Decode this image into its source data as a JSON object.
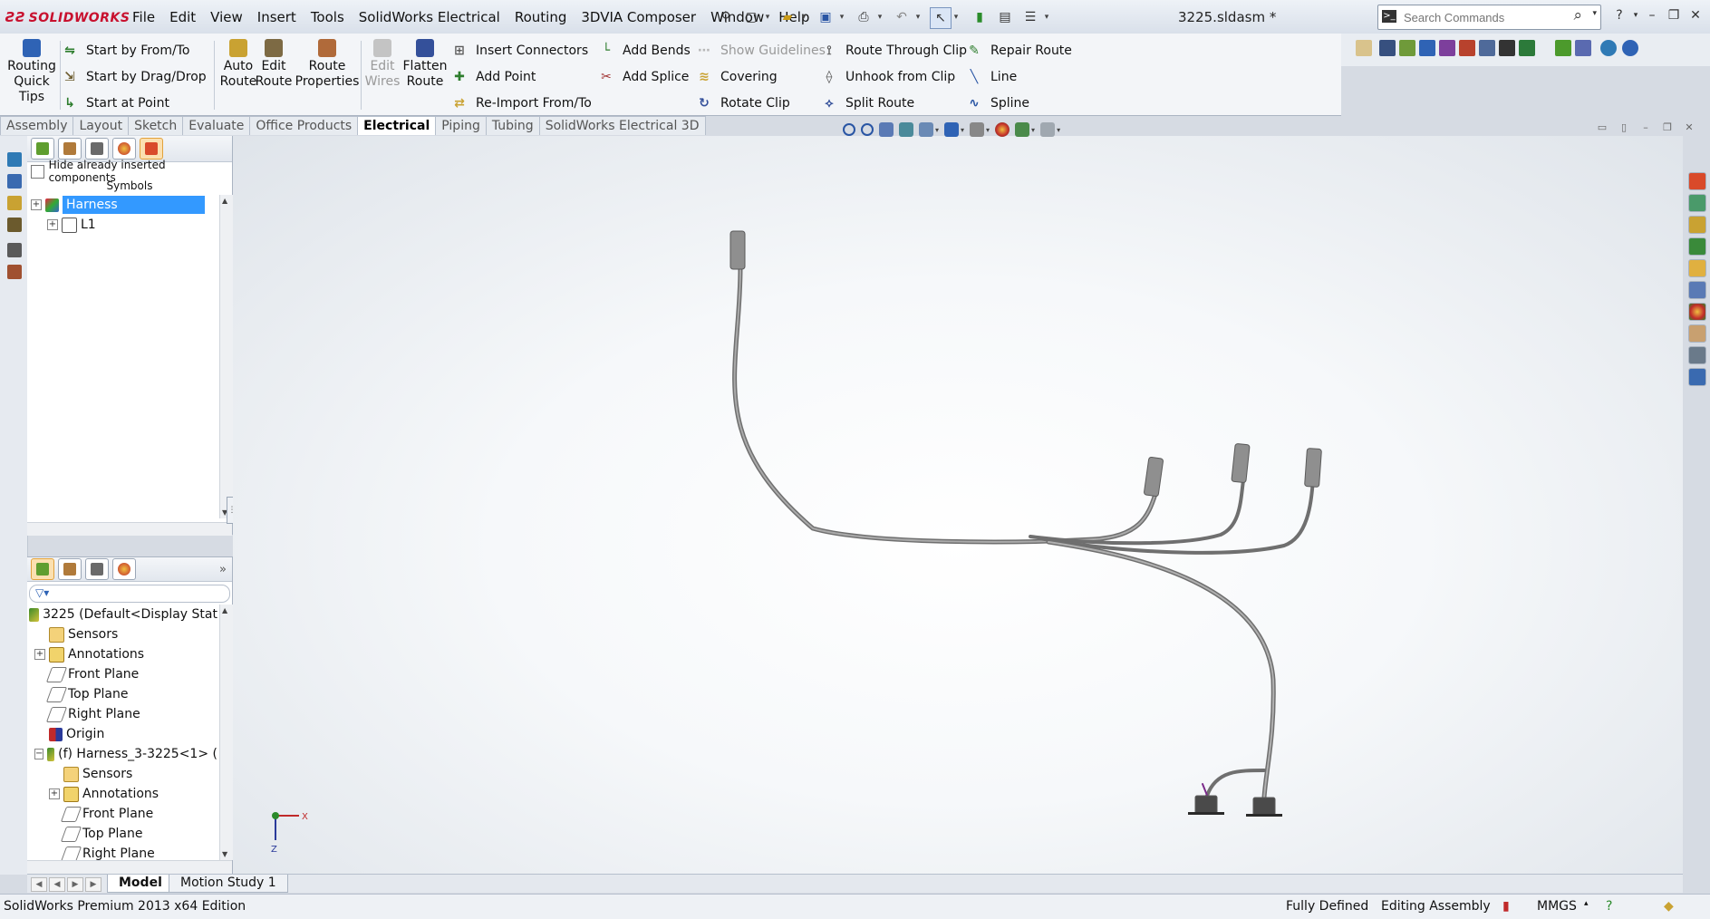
{
  "app": {
    "logo": "SOLIDWORKS",
    "document_title": "3225.sldasm *"
  },
  "menu": [
    "File",
    "Edit",
    "View",
    "Insert",
    "Tools",
    "SolidWorks Electrical",
    "Routing",
    "3DVIA Composer",
    "Window",
    "Help"
  ],
  "search": {
    "placeholder": "Search Commands"
  },
  "toolbar": {
    "big_buttons": [
      {
        "label": "Routing Quick Tips",
        "lines": [
          "Routing",
          "Quick",
          "Tips"
        ],
        "enabled": true
      },
      {
        "label": "Auto Route",
        "lines": [
          "Auto",
          "Route"
        ],
        "enabled": true
      },
      {
        "label": "Edit Route",
        "lines": [
          "Edit",
          "Route"
        ],
        "enabled": true
      },
      {
        "label": "Route Properties",
        "lines": [
          "Route",
          "Properties"
        ],
        "enabled": true
      },
      {
        "label": "Edit Wires",
        "lines": [
          "Edit",
          "Wires"
        ],
        "enabled": false
      },
      {
        "label": "Flatten Route",
        "lines": [
          "Flatten",
          "Route"
        ],
        "enabled": true
      }
    ],
    "col_start": [
      "Start by From/To",
      "Start by Drag/Drop",
      "Start at Point"
    ],
    "col_insert": [
      "Insert Connectors",
      "Add Point",
      "Re-Import From/To"
    ],
    "col_bends": [
      "Add Bends",
      "Add Splice"
    ],
    "col_guides": [
      {
        "label": "Show Guidelines",
        "enabled": false
      },
      {
        "label": "Covering",
        "enabled": true
      },
      {
        "label": "Rotate Clip",
        "enabled": true
      }
    ],
    "col_clip": [
      "Route Through Clip",
      "Unhook from Clip",
      "Split Route"
    ],
    "col_repair": [
      "Repair Route",
      "Line",
      "Spline"
    ]
  },
  "tabs": [
    {
      "label": "Assembly",
      "active": false
    },
    {
      "label": "Layout",
      "active": false
    },
    {
      "label": "Sketch",
      "active": false
    },
    {
      "label": "Evaluate",
      "active": false
    },
    {
      "label": "Office Products",
      "active": false
    },
    {
      "label": "Electrical",
      "active": true
    },
    {
      "label": "Piping",
      "active": false
    },
    {
      "label": "Tubing",
      "active": false
    },
    {
      "label": "SolidWorks Electrical 3D",
      "active": false
    }
  ],
  "symbols_panel": {
    "hide_label": "Hide already inserted components",
    "symbols_label": "Symbols",
    "items": [
      {
        "label": "Harness",
        "selected": true
      },
      {
        "label": "L1",
        "selected": false
      }
    ]
  },
  "feature_tree": {
    "root": "3225  (Default<Display Stat",
    "items": [
      {
        "label": "Sensors",
        "indent": 1,
        "icon": "sensor-icon",
        "expander": ""
      },
      {
        "label": "Annotations",
        "indent": 1,
        "icon": "annotation-icon",
        "expander": "+"
      },
      {
        "label": "Front Plane",
        "indent": 1,
        "icon": "plane-icon",
        "expander": ""
      },
      {
        "label": "Top Plane",
        "indent": 1,
        "icon": "plane-icon",
        "expander": ""
      },
      {
        "label": "Right Plane",
        "indent": 1,
        "icon": "plane-icon",
        "expander": ""
      },
      {
        "label": "Origin",
        "indent": 1,
        "icon": "origin-icon",
        "expander": ""
      },
      {
        "label": "(f) Harness_3-3225<1> (",
        "indent": 1,
        "icon": "assembly-icon",
        "expander": "-"
      },
      {
        "label": "Sensors",
        "indent": 2,
        "icon": "sensor-icon",
        "expander": ""
      },
      {
        "label": "Annotations",
        "indent": 2,
        "icon": "annotation-icon",
        "expander": "+"
      },
      {
        "label": "Front Plane",
        "indent": 2,
        "icon": "plane-icon",
        "expander": ""
      },
      {
        "label": "Top Plane",
        "indent": 2,
        "icon": "plane-icon",
        "expander": ""
      },
      {
        "label": "Right Plane",
        "indent": 2,
        "icon": "plane-icon",
        "expander": ""
      }
    ]
  },
  "triad": {
    "x": "X",
    "z": "Z"
  },
  "bottom_tabs": [
    {
      "label": "Model",
      "active": true
    },
    {
      "label": "Motion Study 1",
      "active": false
    }
  ],
  "status": {
    "edition": "SolidWorks Premium 2013 x64 Edition",
    "state": "Fully Defined",
    "mode": "Editing Assembly",
    "units": "MMGS"
  },
  "colors": {
    "brand": "#c8102e",
    "selection": "#3399ff",
    "harness": "#8c8c8c",
    "connector": "#9a9a9a"
  }
}
